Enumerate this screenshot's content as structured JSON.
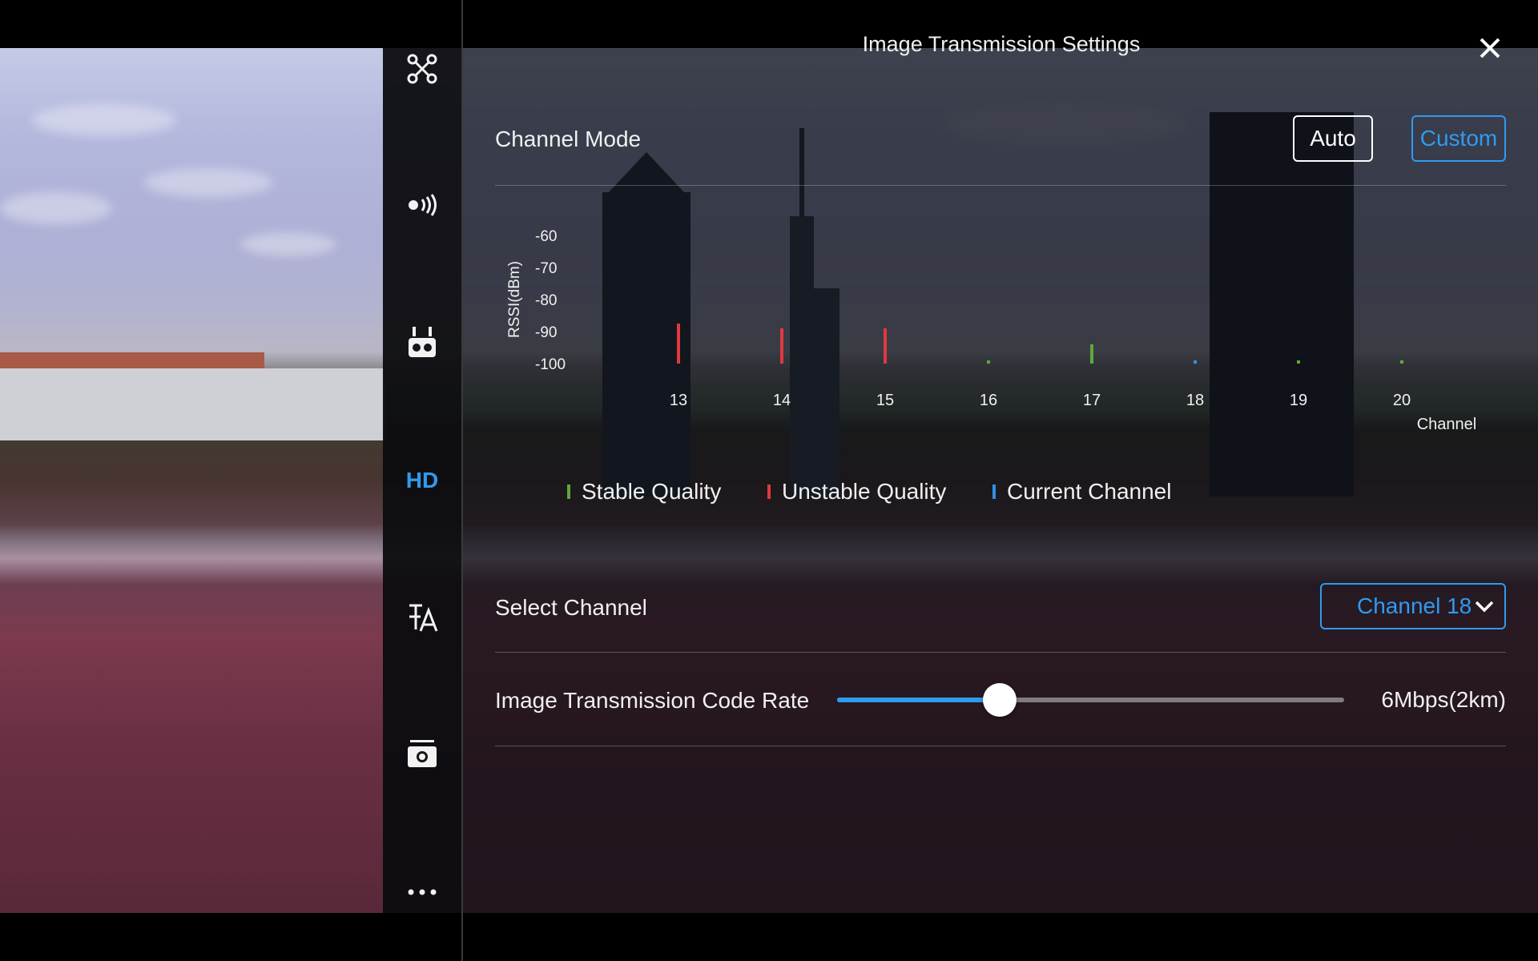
{
  "header": {
    "title": "Image Transmission Settings"
  },
  "sidebar": {
    "items": [
      {
        "name": "aircraft",
        "icon": "drone-icon"
      },
      {
        "name": "signal",
        "icon": "signal-waves-icon"
      },
      {
        "name": "remote-controller",
        "icon": "remote-controller-icon"
      },
      {
        "name": "hd",
        "label": "HD",
        "active": true
      },
      {
        "name": "translate",
        "icon": "translate-icon"
      },
      {
        "name": "camera",
        "icon": "camera-icon"
      },
      {
        "name": "more",
        "icon": "more-dots-icon"
      }
    ]
  },
  "channel_mode": {
    "label": "Channel Mode",
    "options": [
      "Auto",
      "Custom"
    ],
    "selected": "Custom"
  },
  "chart_data": {
    "type": "bar",
    "ylabel": "RSSI(dBm)",
    "xlabel": "Channel",
    "yticks": [
      "-60",
      "-70",
      "-80",
      "-90",
      "-100"
    ],
    "ylim": [
      -100,
      -60
    ],
    "categories": [
      "13",
      "14",
      "15",
      "16",
      "17",
      "18",
      "19",
      "20"
    ],
    "values": [
      -87.5,
      -89,
      -89,
      -99,
      -94,
      -99,
      -99,
      -99
    ],
    "quality": [
      "unstable",
      "unstable",
      "unstable",
      "stable",
      "stable",
      "current",
      "stable",
      "stable"
    ],
    "colors": {
      "stable": "#5fa83a",
      "unstable": "#e0393f",
      "current": "#2f8fe6"
    },
    "legend": [
      {
        "label": "Stable Quality",
        "key": "stable"
      },
      {
        "label": "Unstable Quality",
        "key": "unstable"
      },
      {
        "label": "Current Channel",
        "key": "current"
      }
    ]
  },
  "select_channel": {
    "label": "Select Channel",
    "value": "Channel 18"
  },
  "code_rate": {
    "label": "Image Transmission Code Rate",
    "value_text": "6Mbps(2km)",
    "slider_fraction": 0.32
  },
  "colors": {
    "accent": "#2f9bf0"
  }
}
